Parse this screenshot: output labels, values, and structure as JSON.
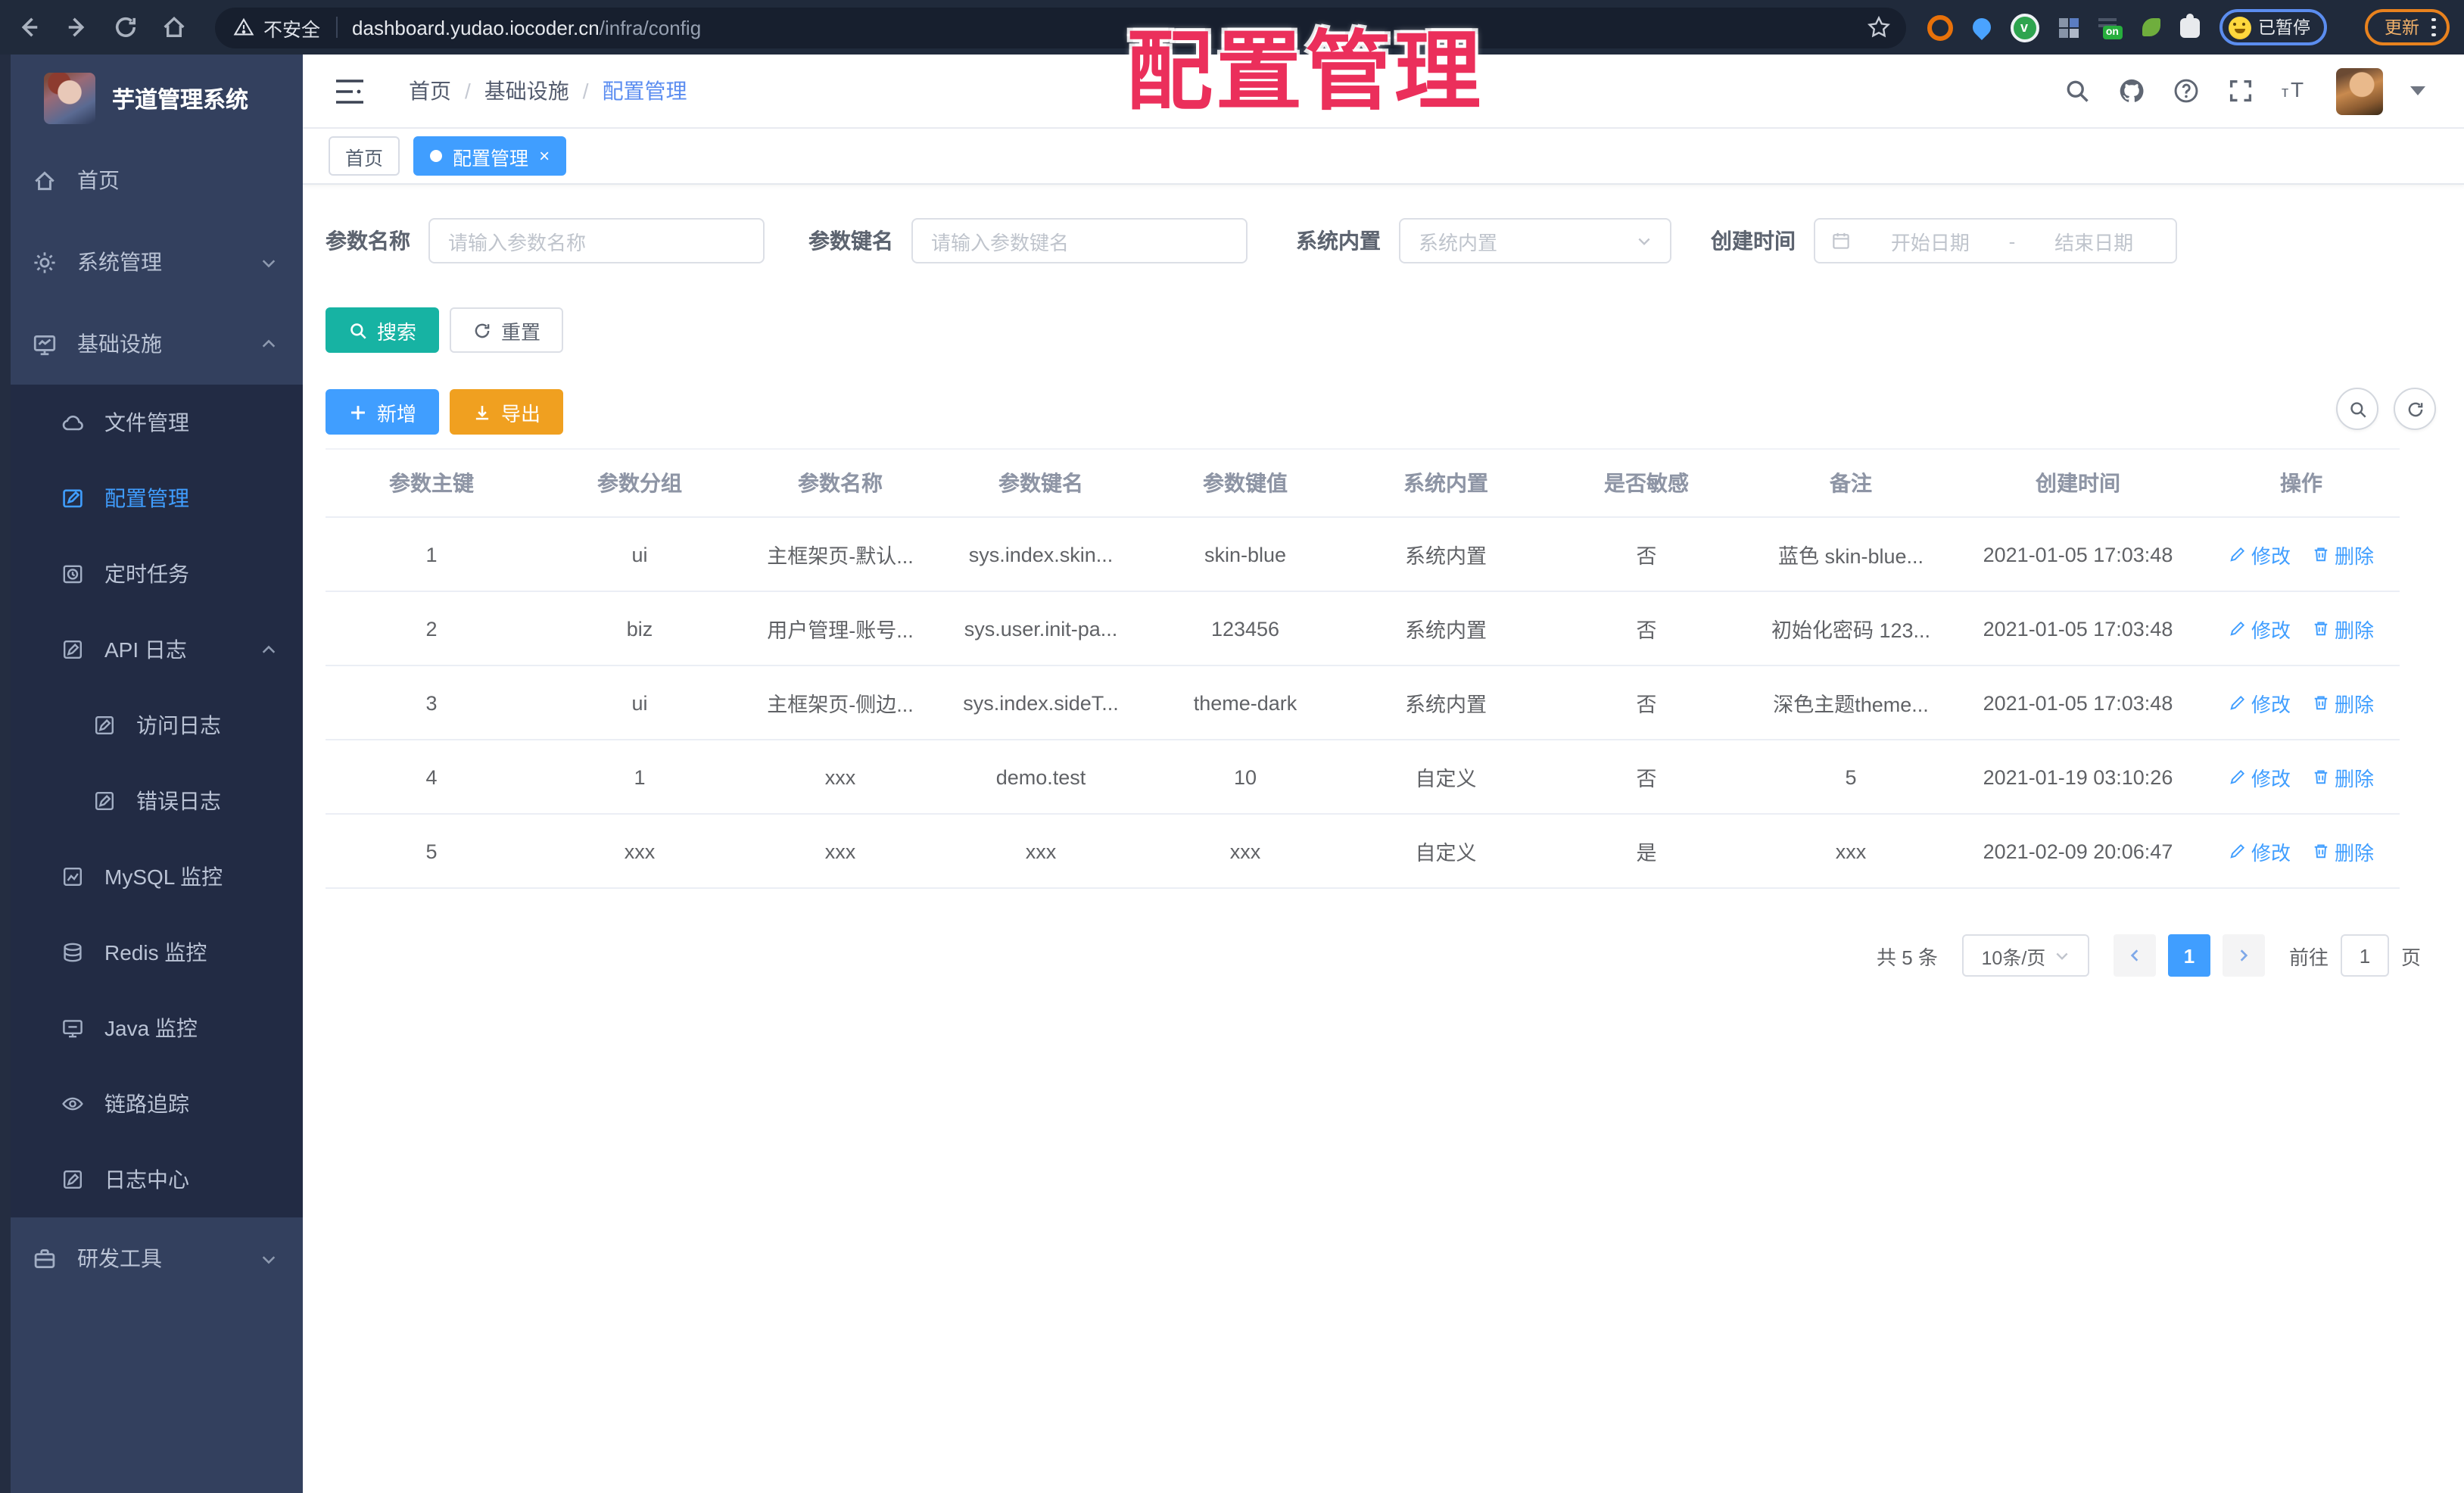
{
  "colors": {
    "accent": "#409eff",
    "search_teal": "#17b3a3",
    "export_orange": "#f0a020",
    "sidebar_bg": "#33405e",
    "submenu_bg": "#222b44",
    "overlay_red": "#eb2f5b"
  },
  "overlay": {
    "title": "配置管理"
  },
  "browser": {
    "security_text": "不安全",
    "url_host": "dashboard.yudao.iocoder.cn",
    "url_path": "/infra/config",
    "paused_badge": "已暂停",
    "update_button": "更新"
  },
  "sidebar": {
    "app_title": "芋道管理系统",
    "items": [
      {
        "label": "首页"
      },
      {
        "label": "系统管理"
      },
      {
        "label": "基础设施",
        "children": [
          {
            "label": "文件管理"
          },
          {
            "label": "配置管理",
            "active": true
          },
          {
            "label": "定时任务"
          },
          {
            "label": "API 日志",
            "children": [
              {
                "label": "访问日志"
              },
              {
                "label": "错误日志"
              }
            ]
          },
          {
            "label": "MySQL 监控"
          },
          {
            "label": "Redis 监控"
          },
          {
            "label": "Java 监控"
          },
          {
            "label": "链路追踪"
          },
          {
            "label": "日志中心"
          }
        ]
      },
      {
        "label": "研发工具"
      }
    ]
  },
  "header": {
    "breadcrumb": [
      "首页",
      "基础设施",
      "配置管理"
    ]
  },
  "tabs": [
    {
      "label": "首页",
      "active": false
    },
    {
      "label": "配置管理",
      "active": true
    }
  ],
  "filters": {
    "name_label": "参数名称",
    "name_placeholder": "请输入参数名称",
    "key_label": "参数键名",
    "key_placeholder": "请输入参数键名",
    "builtin_label": "系统内置",
    "builtin_placeholder": "系统内置",
    "time_label": "创建时间",
    "start_placeholder": "开始日期",
    "range_separator": "-",
    "end_placeholder": "结束日期"
  },
  "actions": {
    "search": "搜索",
    "reset": "重置",
    "add": "新增",
    "export": "导出"
  },
  "table": {
    "columns": [
      "参数主键",
      "参数分组",
      "参数名称",
      "参数键名",
      "参数键值",
      "系统内置",
      "是否敏感",
      "备注",
      "创建时间",
      "操作"
    ],
    "edit_label": "修改",
    "delete_label": "删除",
    "rows": [
      [
        "1",
        "ui",
        "主框架页-默认...",
        "sys.index.skin...",
        "skin-blue",
        "系统内置",
        "否",
        "蓝色 skin-blue...",
        "2021-01-05 17:03:48"
      ],
      [
        "2",
        "biz",
        "用户管理-账号...",
        "sys.user.init-pa...",
        "123456",
        "系统内置",
        "否",
        "初始化密码 123...",
        "2021-01-05 17:03:48"
      ],
      [
        "3",
        "ui",
        "主框架页-侧边...",
        "sys.index.sideT...",
        "theme-dark",
        "系统内置",
        "否",
        "深色主题theme...",
        "2021-01-05 17:03:48"
      ],
      [
        "4",
        "1",
        "xxx",
        "demo.test",
        "10",
        "自定义",
        "否",
        "5",
        "2021-01-19 03:10:26"
      ],
      [
        "5",
        "xxx",
        "xxx",
        "xxx",
        "xxx",
        "自定义",
        "是",
        "xxx",
        "2021-02-09 20:06:47"
      ]
    ]
  },
  "pagination": {
    "total": "共 5 条",
    "page_size": "10条/页",
    "current": "1",
    "goto_label": "前往",
    "goto_value": "1",
    "page_unit": "页"
  }
}
